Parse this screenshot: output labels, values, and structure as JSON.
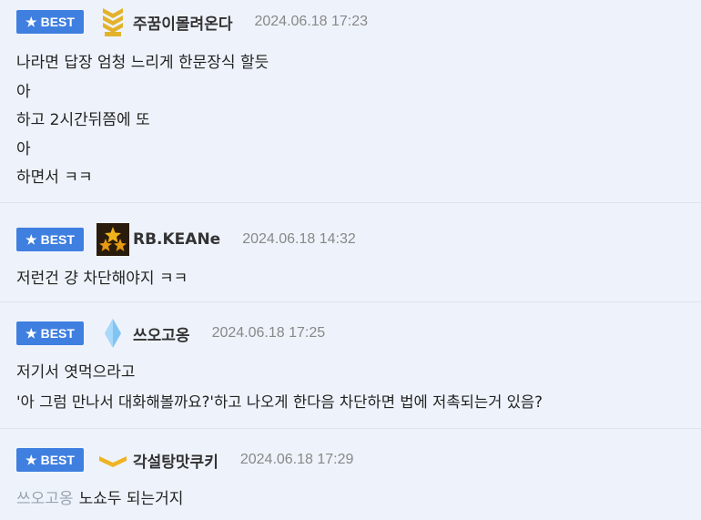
{
  "comments": [
    {
      "badge": "BEST",
      "nick": "주꿈이몰려온다",
      "date": "2024.06.18 17:23",
      "lines": [
        "나라면 답장 엄청 느리게 한문장식 할듯",
        "아",
        "하고 2시간뒤쯤에 또",
        "아",
        "하면서 ㅋㅋ"
      ],
      "icon": "gold-chevron-rank-icon"
    },
    {
      "badge": "BEST",
      "nick": "RB.KEANe",
      "date": "2024.06.18 14:32",
      "lines": [
        "저런건 걍 차단해야지 ㅋㅋ"
      ],
      "icon": "three-stars-rank-icon"
    },
    {
      "badge": "BEST",
      "nick": "쓰오고옹",
      "date": "2024.06.18 17:25",
      "lines": [
        "저기서 엿먹으라고",
        "'아 그럼 만나서 대화해볼까요?'하고 나오게 한다음 차단하면 법에 저촉되는거 있음?"
      ],
      "icon": "blue-diamond-rank-icon"
    },
    {
      "badge": "BEST",
      "nick": "각설탕맛쿠키",
      "date": "2024.06.18 17:29",
      "mention": "쓰오고옹",
      "lines": [
        "노쇼두 되는거지"
      ],
      "icon": "gold-single-chevron-rank-icon"
    }
  ]
}
